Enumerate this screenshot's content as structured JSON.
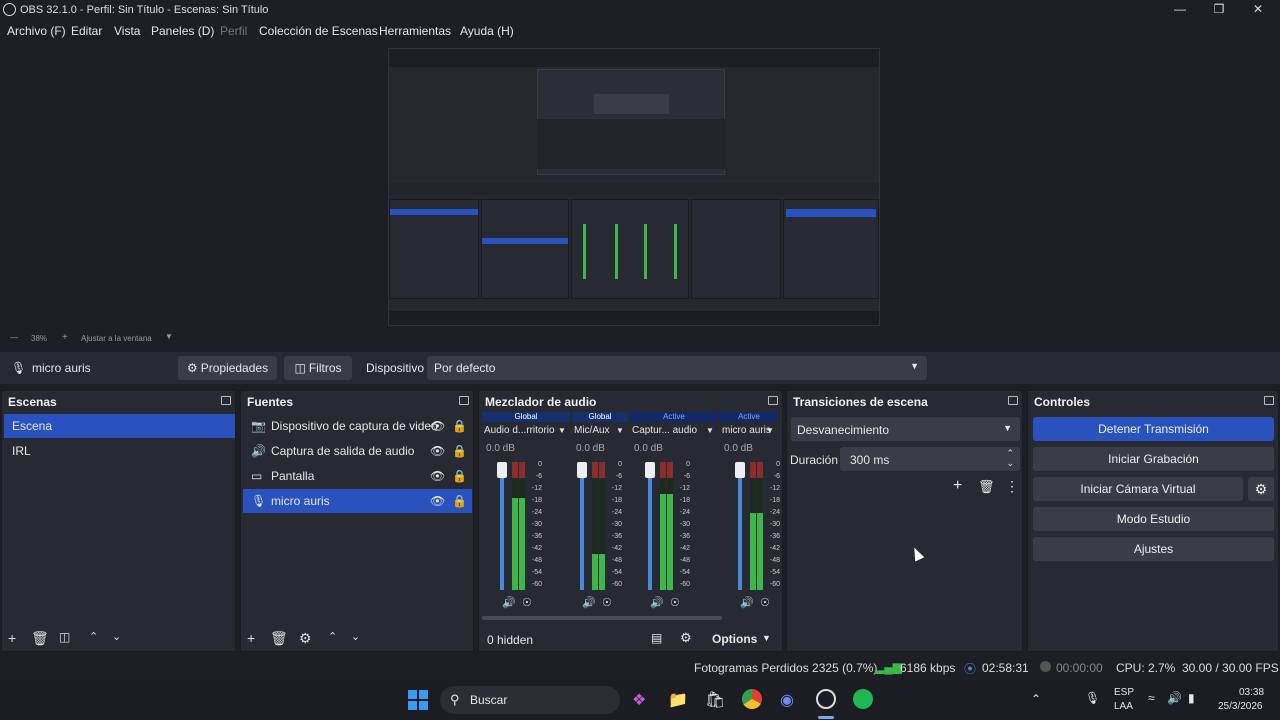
{
  "window": {
    "title": "OBS 32.1.0 - Perfil: Sin Título - Escenas: Sin Título"
  },
  "menu": [
    "Archivo (F)",
    "Editar",
    "Vista",
    "Paneles (D)",
    "Perfil",
    "Colección de Escenas",
    "Herramientas",
    "Ayuda (H)"
  ],
  "zoom": {
    "level": "38%",
    "fit": "Ajustar a la ventana"
  },
  "source_bar": {
    "source": "micro auris",
    "properties": "Propiedades",
    "filters": "Filtros",
    "device_label": "Dispositivo",
    "device_value": "Por defecto"
  },
  "scenes": {
    "title": "Escenas",
    "items": [
      "Escena",
      "IRL"
    ],
    "selected": 0
  },
  "sources": {
    "title": "Fuentes",
    "items": [
      "Dispositivo de captura de video",
      "Captura de salida de audio",
      "Pantalla",
      "micro auris"
    ],
    "selected": 3
  },
  "mixer": {
    "title": "Mezclador de audio",
    "channels": [
      {
        "tag": "Global",
        "name": "Audio d...rritorio",
        "db": "0.0 dB",
        "level": 0.72,
        "color": "#4a88d8"
      },
      {
        "tag": "Global",
        "name": "Mic/Aux",
        "db": "0.0 dB",
        "level": 0.28,
        "color": "#4a88d8"
      },
      {
        "tag": "Active",
        "name": "Captur... audio",
        "db": "0.0 dB",
        "level": 0.75,
        "color": "#4a88d8"
      },
      {
        "tag": "Active",
        "name": "micro auris",
        "db": "0.0 dB",
        "level": 0.6,
        "color": "#4a88d8"
      }
    ],
    "scale": [
      "0",
      "-6",
      "-12",
      "-18",
      "-24",
      "-30",
      "-36",
      "-42",
      "-48",
      "-54",
      "-60"
    ],
    "hidden": "0 hidden",
    "options": "Options"
  },
  "transitions": {
    "title": "Transiciones de escena",
    "type": "Desvanecimiento",
    "duration_label": "Duración",
    "duration_value": "300 ms"
  },
  "controls": {
    "title": "Controles",
    "buttons": [
      "Detener Transmisión",
      "Iniciar Grabación",
      "Iniciar Cámara Virtual",
      "Modo Estudio",
      "Ajustes"
    ]
  },
  "status": {
    "dropped": "Fotogramas Perdidos 2325 (0.7%)",
    "bitrate": "6186 kbps",
    "stream_time": "02:58:31",
    "rec_time": "00:00:00",
    "cpu": "CPU: 2.7%",
    "fps": "30.00 / 30.00 FPS"
  },
  "taskbar": {
    "search": "Buscar",
    "lang1": "ESP",
    "lang2": "LAA",
    "time": "03:38",
    "date": "25/3/2026"
  },
  "colors": {
    "accent": "#2a52be",
    "meter_green": "#3cb84a",
    "meter_yellow": "#c9b52a",
    "meter_red": "#b83030"
  }
}
